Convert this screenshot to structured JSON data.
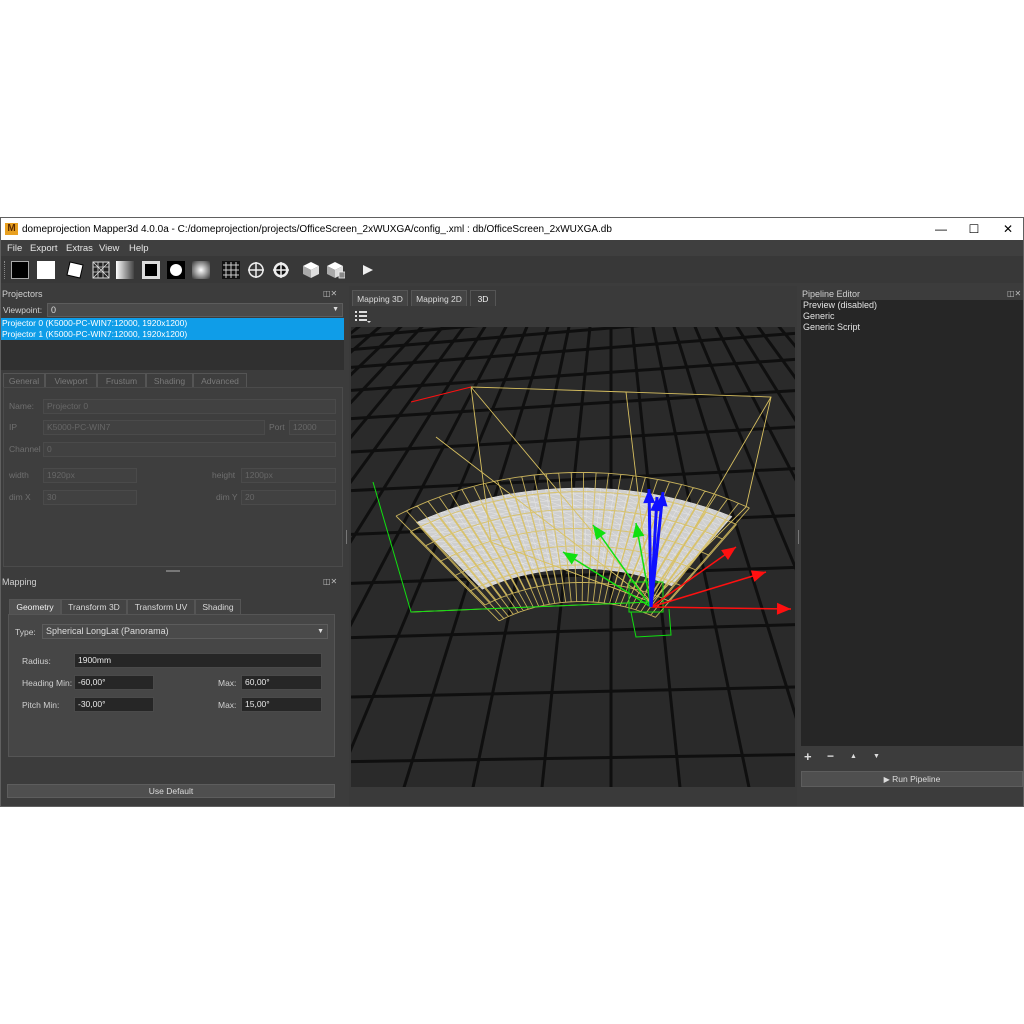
{
  "window": {
    "title": "domeprojection Mapper3d 4.0.0a - C:/domeprojection/projects/OfficeScreen_2xWUXGA/config_.xml : db/OfficeScreen_2xWUXGA.db",
    "logo_letter": "M",
    "minimize": "—",
    "maximize": "☐",
    "close": "✕"
  },
  "menu": [
    "File",
    "Export",
    "Extras",
    "View",
    "Help"
  ],
  "toolbar_icons": [
    "black-square-icon",
    "white-square-icon",
    "rotated-square-icon",
    "mesh-square-icon",
    "gradient-square-icon",
    "frame-square-icon",
    "circle-icon",
    "radial-gradient-icon",
    "grid-icon",
    "crosshair-icon",
    "crosshair-filled-icon",
    "cube-icon",
    "cube-multi-icon",
    "play-icon"
  ],
  "projectors_panel": {
    "title": "Projectors",
    "viewpoint_label": "Viewpoint:",
    "viewpoint_value": "0",
    "items": [
      "Projector 0 (K5000-PC-WIN7:12000, 1920x1200)",
      "Projector 1 (K5000-PC-WIN7:12000, 1920x1200)"
    ],
    "tabs": [
      "General",
      "Viewport",
      "Frustum",
      "Shading",
      "Advanced"
    ],
    "fields": {
      "name_label": "Name:",
      "name_value": "Projector 0",
      "ip_label": "IP",
      "ip_value": "K5000-PC-WIN7",
      "port_label": "Port",
      "port_value": "12000",
      "channel_label": "Channel",
      "channel_value": "0",
      "width_label": "width",
      "width_value": "1920px",
      "height_label": "height",
      "height_value": "1200px",
      "dimx_label": "dim X",
      "dimx_value": "30",
      "dimy_label": "dim Y",
      "dimy_value": "20"
    }
  },
  "mapping_panel": {
    "title": "Mapping",
    "tabs": [
      "Geometry",
      "Transform 3D",
      "Transform UV",
      "Shading"
    ],
    "type_label": "Type:",
    "type_value": "Spherical LongLat (Panorama)",
    "radius_label": "Radius:",
    "radius_value": "1900mm",
    "heading_min_label": "Heading Min:",
    "heading_min_value": "-60,00°",
    "heading_max_label": "Max:",
    "heading_max_value": "60,00°",
    "pitch_min_label": "Pitch Min:",
    "pitch_min_value": "-30,00°",
    "pitch_max_label": "Max:",
    "pitch_max_value": "15,00°",
    "use_default": "Use Default"
  },
  "viewport": {
    "tabs": [
      "Mapping 3D",
      "Mapping 2D",
      "3D"
    ],
    "active_tab": "3D",
    "colors": {
      "background": "#2a2a2a",
      "grid": "#0f0f0f",
      "frustum": "#d8c060",
      "mesh": "#e8e8e8",
      "x_axis": "#ff1010",
      "y_axis": "#10e010",
      "z_axis": "#1010ff"
    }
  },
  "pipeline_panel": {
    "title": "Pipeline Editor",
    "items": [
      "Preview (disabled)",
      "Generic",
      "Generic Script"
    ],
    "controls": [
      "+",
      "−",
      "▲",
      "▼"
    ],
    "run_button": "Run Pipeline"
  },
  "dock_buttons": "◫✕"
}
